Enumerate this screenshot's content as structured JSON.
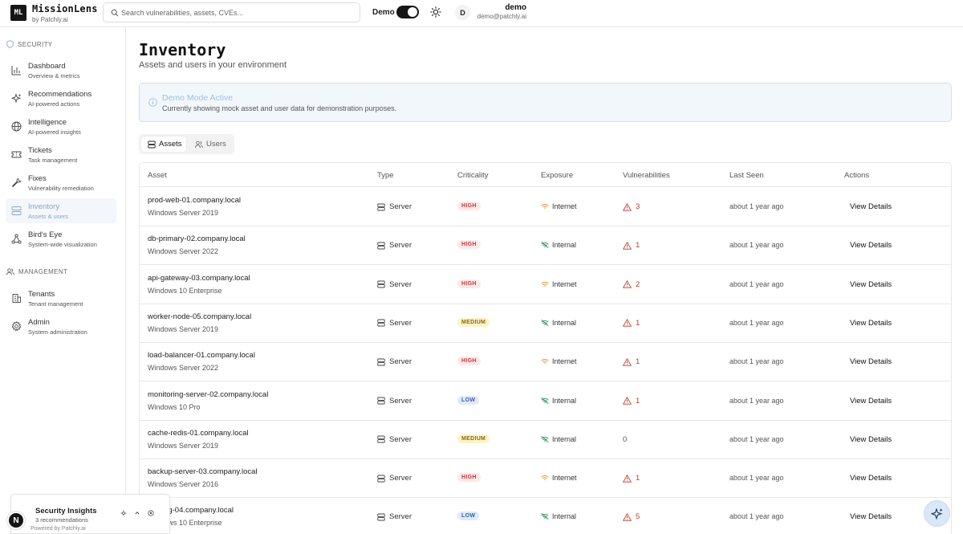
{
  "brand": {
    "logo": "ML",
    "name": "MissionLens",
    "sub": "by Patchly.ai"
  },
  "search": {
    "placeholder": "Search vulnerabilities, assets, CVEs..."
  },
  "header": {
    "demo_label": "Demo",
    "user_initial": "D",
    "user_name": "demo",
    "user_email": "demo@patchly.ai"
  },
  "sidebar": {
    "security_heading": "SECURITY",
    "management_heading": "MANAGEMENT",
    "items": [
      {
        "title": "Dashboard",
        "subtitle": "Overview & metrics"
      },
      {
        "title": "Recommendations",
        "subtitle": "AI-powered actions"
      },
      {
        "title": "Intelligence",
        "subtitle": "AI-powered insights"
      },
      {
        "title": "Tickets",
        "subtitle": "Task management"
      },
      {
        "title": "Fixes",
        "subtitle": "Vulnerability remediation"
      },
      {
        "title": "Inventory",
        "subtitle": "Assets & users"
      },
      {
        "title": "Bird's Eye",
        "subtitle": "System-wide visualization"
      },
      {
        "title": "Tenants",
        "subtitle": "Tenant management"
      },
      {
        "title": "Admin",
        "subtitle": "System administration"
      }
    ]
  },
  "main": {
    "title": "Inventory",
    "subtitle": "Assets and users in your environment",
    "banner_title": "Demo Mode Active",
    "banner_text": "Currently showing mock asset and user data for demonstration purposes.",
    "tabs": [
      {
        "label": "Assets"
      },
      {
        "label": "Users"
      }
    ]
  },
  "table": {
    "headers": [
      "Asset",
      "Type",
      "Criticality",
      "Exposure",
      "Vulnerabilities",
      "Last Seen",
      "Actions"
    ],
    "rows": [
      {
        "name": "prod-web-01.company.local",
        "os": "Windows Server 2019",
        "type": "Server",
        "criticality": "HIGH",
        "exposure": "Internet",
        "vulns": "3",
        "seen": "about 1 year ago",
        "action": "View Details"
      },
      {
        "name": "db-primary-02.company.local",
        "os": "Windows Server 2022",
        "type": "Server",
        "criticality": "HIGH",
        "exposure": "Internal",
        "vulns": "1",
        "seen": "about 1 year ago",
        "action": "View Details"
      },
      {
        "name": "api-gateway-03.company.local",
        "os": "Windows 10 Enterprise",
        "type": "Server",
        "criticality": "HIGH",
        "exposure": "Internet",
        "vulns": "2",
        "seen": "about 1 year ago",
        "action": "View Details"
      },
      {
        "name": "worker-node-05.company.local",
        "os": "Windows Server 2019",
        "type": "Server",
        "criticality": "MEDIUM",
        "exposure": "Internal",
        "vulns": "1",
        "seen": "about 1 year ago",
        "action": "View Details"
      },
      {
        "name": "load-balancer-01.company.local",
        "os": "Windows Server 2022",
        "type": "Server",
        "criticality": "HIGH",
        "exposure": "Internet",
        "vulns": "1",
        "seen": "about 1 year ago",
        "action": "View Details"
      },
      {
        "name": "monitoring-server-02.company.local",
        "os": "Windows 10 Pro",
        "type": "Server",
        "criticality": "LOW",
        "exposure": "Internal",
        "vulns": "1",
        "seen": "about 1 year ago",
        "action": "View Details"
      },
      {
        "name": "cache-redis-01.company.local",
        "os": "Windows Server 2019",
        "type": "Server",
        "criticality": "MEDIUM",
        "exposure": "Internal",
        "vulns": "0",
        "seen": "about 1 year ago",
        "action": "View Details"
      },
      {
        "name": "backup-server-03.company.local",
        "os": "Windows Server 2016",
        "type": "Server",
        "criticality": "HIGH",
        "exposure": "Internet",
        "vulns": "1",
        "seen": "about 1 year ago",
        "action": "View Details"
      },
      {
        "name": "staging-04.company.local",
        "os": "Windows 10 Enterprise",
        "type": "Server",
        "criticality": "LOW",
        "exposure": "Internal",
        "vulns": "5",
        "seen": "about 1 year ago",
        "action": "View Details"
      }
    ]
  },
  "insights": {
    "title": "Security Insights",
    "subtitle": "3 recommendations",
    "powered": "Powered by Patchly.ai",
    "badge": "N"
  },
  "colors": {
    "accent": "#8aa6c8",
    "high": "#c43a3a",
    "medium": "#8a6a10",
    "low": "#3a5f9c",
    "internet": "#e0942b",
    "internal": "#2e9a5a"
  }
}
